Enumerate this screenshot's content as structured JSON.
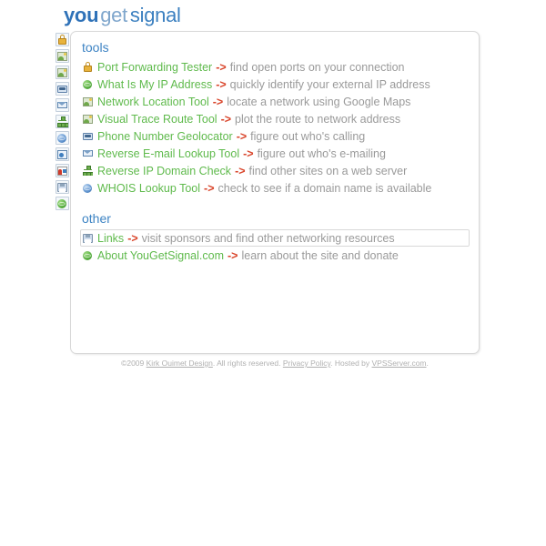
{
  "logo": {
    "part1": "you",
    "part2": "get",
    "part3": "signal"
  },
  "colors": {
    "link_green": "#5FBA4C",
    "arrow_red": "#D9452B",
    "heading_blue": "#3E84C4",
    "desc_gray": "#9a9a9a",
    "logo_blue": "#2F72B8",
    "logo_dot_green": "#6FBF4A"
  },
  "sections": [
    {
      "id": "tools",
      "title": "tools",
      "rows": [
        {
          "icon": "padlock-icon",
          "link": "Port Forwarding Tester",
          "arrow": "->",
          "desc": "find open ports on your connection",
          "focused": false
        },
        {
          "icon": "green-globe-icon",
          "link": "What Is My IP Address",
          "arrow": "->",
          "desc": "quickly identify your external IP address",
          "focused": false
        },
        {
          "icon": "map-tile-icon",
          "link": "Network Location Tool",
          "arrow": "->",
          "desc": "locate a network using Google Maps",
          "focused": false
        },
        {
          "icon": "map-tile-icon",
          "link": "Visual Trace Route Tool",
          "arrow": "->",
          "desc": "plot the route to network address",
          "focused": false
        },
        {
          "icon": "telephone-icon",
          "link": "Phone Number Geolocator",
          "arrow": "->",
          "desc": "figure out who's calling",
          "focused": false
        },
        {
          "icon": "envelope-icon",
          "link": "Reverse E-mail Lookup Tool",
          "arrow": "->",
          "desc": "figure out who's e-mailing",
          "focused": false
        },
        {
          "icon": "network-tree-icon",
          "link": "Reverse IP Domain Check",
          "arrow": "->",
          "desc": "find other sites on a web server",
          "focused": false
        },
        {
          "icon": "blue-globe-icon",
          "link": "WHOIS Lookup Tool",
          "arrow": "->",
          "desc": "check to see if a domain name is available",
          "focused": false
        }
      ]
    },
    {
      "id": "other",
      "title": "other",
      "rows": [
        {
          "icon": "floppy-disk-icon",
          "link": "Links",
          "arrow": "->",
          "desc": "visit sponsors and find other networking resources",
          "focused": true
        },
        {
          "icon": "green-globe-icon",
          "link": "About YouGetSignal.com",
          "arrow": "->",
          "desc": "learn about the site and donate",
          "focused": false
        }
      ]
    }
  ],
  "rail": {
    "items": [
      {
        "icon": "padlock-icon"
      },
      {
        "icon": "map-tile-icon"
      },
      {
        "icon": "map-tile-icon"
      },
      {
        "icon": "telephone-icon"
      },
      {
        "icon": "envelope-icon"
      },
      {
        "icon": "network-tree-icon"
      },
      {
        "icon": "blue-globe-icon"
      },
      {
        "icon": "browser-icon"
      },
      {
        "icon": "colorchart-icon"
      },
      {
        "icon": "floppy-disk-icon"
      },
      {
        "icon": "green-globe-icon"
      }
    ]
  },
  "footer": {
    "copyright": "©2009 ",
    "design_link": "Kirk Ouimet Design",
    "rights": ". All rights reserved. ",
    "privacy_link": "Privacy Policy",
    "hosted": ". Hosted by ",
    "host_link": "VPSServer.com",
    "period": "."
  }
}
